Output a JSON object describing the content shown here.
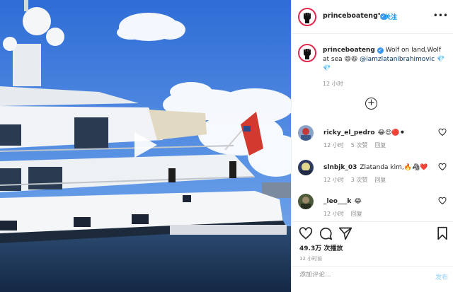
{
  "header": {
    "username": "princeboateng",
    "verified_mark": "✓",
    "separator": "•",
    "follow_label": "关注",
    "more_label": "•••"
  },
  "caption": {
    "username": "princeboateng",
    "text": " Wolf on land,Wolf at sea 😄😆 ",
    "mention": "@iamzlatanibrahimovic",
    "trailing": " 💎💎",
    "time": "12 小时"
  },
  "load_more_label": "+",
  "comments": [
    {
      "username": "ricky_el_pedro",
      "text": "😂😍🔴⚫",
      "time": "12 小时",
      "likes": "5 次赞",
      "reply": "回复",
      "avatar_color": "#8aa2c8"
    },
    {
      "username": "slnbjk_03",
      "text": "Zlatanda kim,🔥🦓❤️",
      "time": "12 小时",
      "likes": "3 次赞",
      "reply": "回复",
      "avatar_color": "#2e3b60"
    },
    {
      "username": "_leo___k",
      "text": "😂",
      "time": "12 小时",
      "likes": "",
      "reply": "回复",
      "avatar_color": "#4a5a3a"
    }
  ],
  "actions": {
    "views": "49.3万 次播放",
    "time": "12 小时前"
  },
  "comment_box": {
    "placeholder": "添加评论...",
    "post_label": "发布"
  },
  "colors": {
    "link": "#0095f6",
    "verified": "#3897f0",
    "avatar_ring": "#e3264c",
    "muted": "#8e8e8e"
  }
}
